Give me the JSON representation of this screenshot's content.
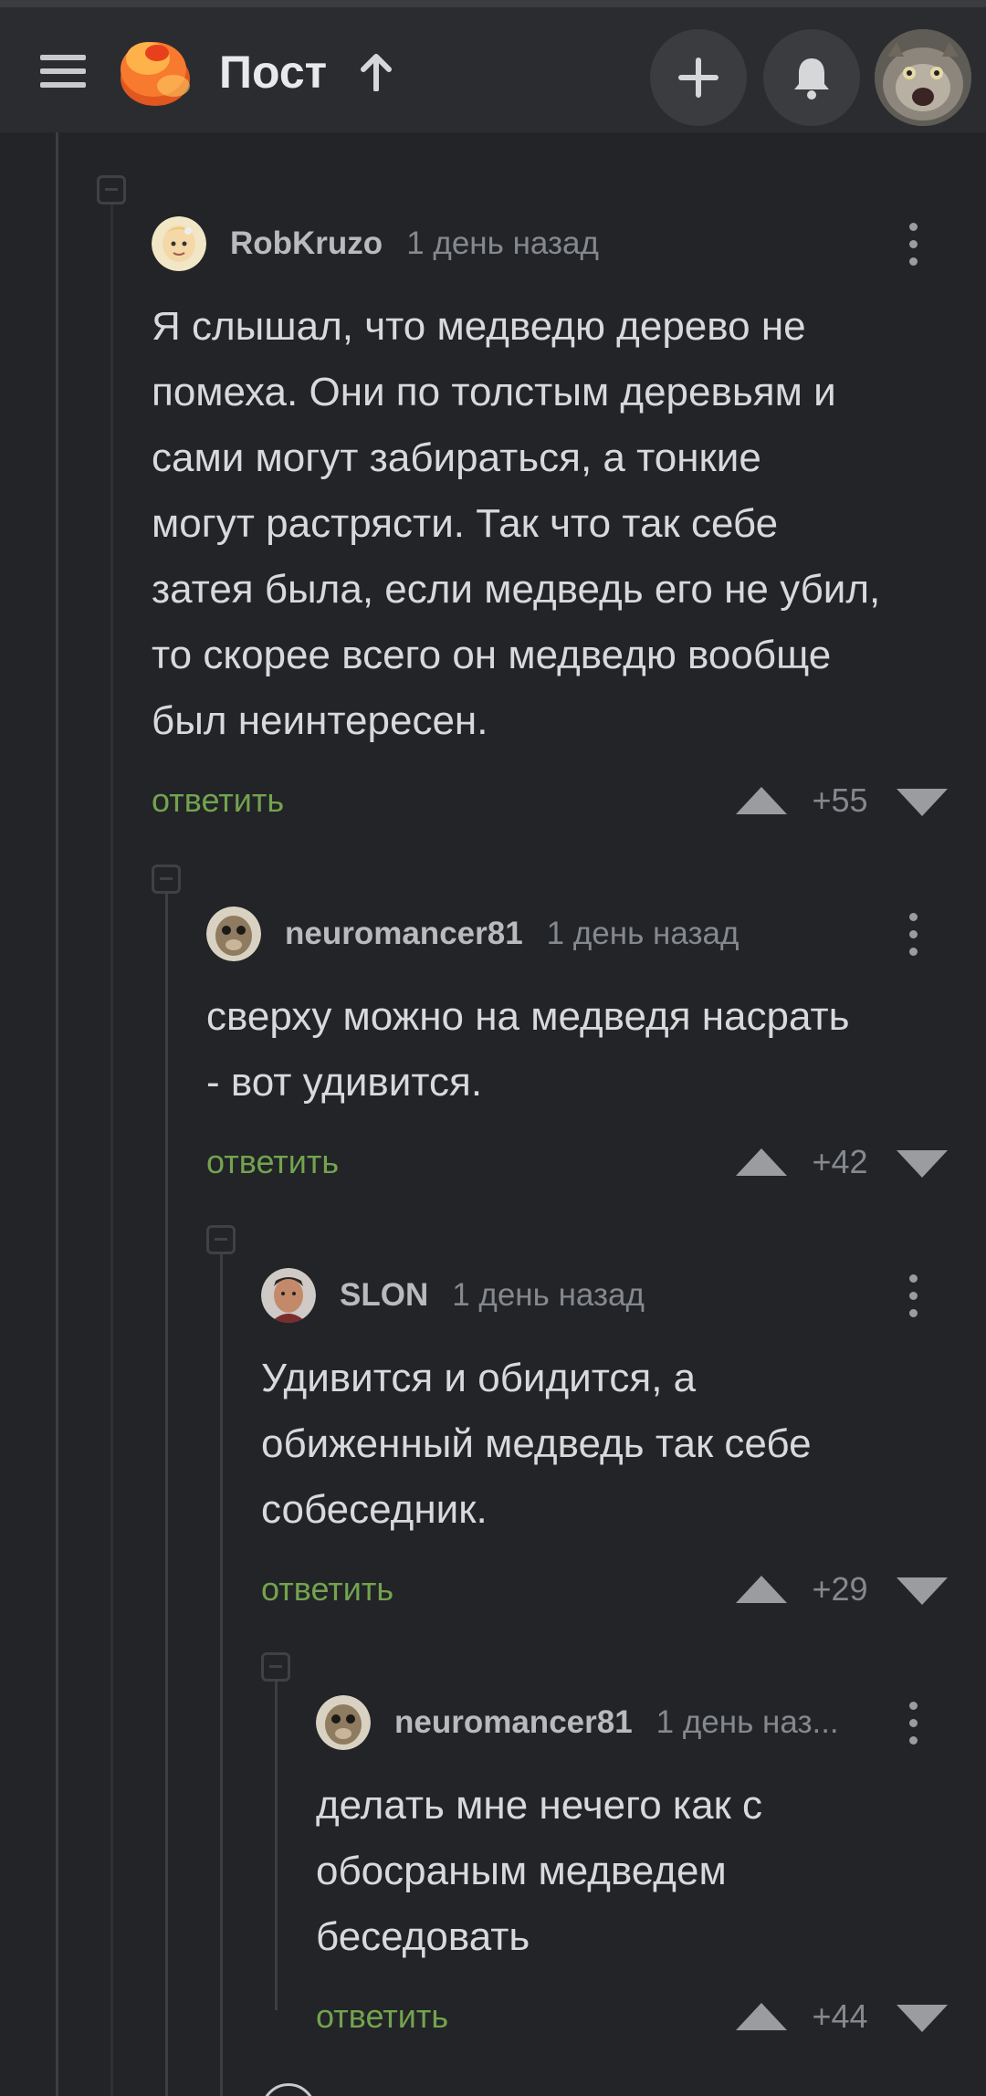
{
  "header": {
    "title": "Пост",
    "icons": [
      "menu-icon",
      "logo-icon",
      "arrow-up-icon",
      "plus-icon",
      "bell-icon"
    ]
  },
  "comments": [
    {
      "user": "RobKruzo",
      "time": "1 день назад",
      "text": "Я слышал, что медведю дерево не\nпомеха. Они по толстым деревьям и\nсами могут забираться, а тонкие\nмогут растрясти. Так что так себе\nзатея была, если медведь его не убил,\nто скорее всего он медведю вообще\nбыл неинтересен.",
      "reply": "ответить",
      "score": "+55"
    },
    {
      "user": "neuromancer81",
      "time": "1 день назад",
      "text": "сверху можно на медведя насрать\n- вот удивится.",
      "reply": "ответить",
      "score": "+42"
    },
    {
      "user": "SLON",
      "time": "1 день назад",
      "text": "Удивится и обидится, а\nобиженный медведь так себе\nсобеседник.",
      "reply": "ответить",
      "score": "+29"
    },
    {
      "user": "neuromancer81",
      "time": "1 день наз...",
      "text": "делать мне нечего как с\nобосраным медведем\nбеседовать",
      "reply": "ответить",
      "score": "+44"
    }
  ],
  "colors": {
    "background": "#222427",
    "header": "#2a2c30",
    "reply_link": "#73a34f",
    "brand": "#f46d28"
  }
}
